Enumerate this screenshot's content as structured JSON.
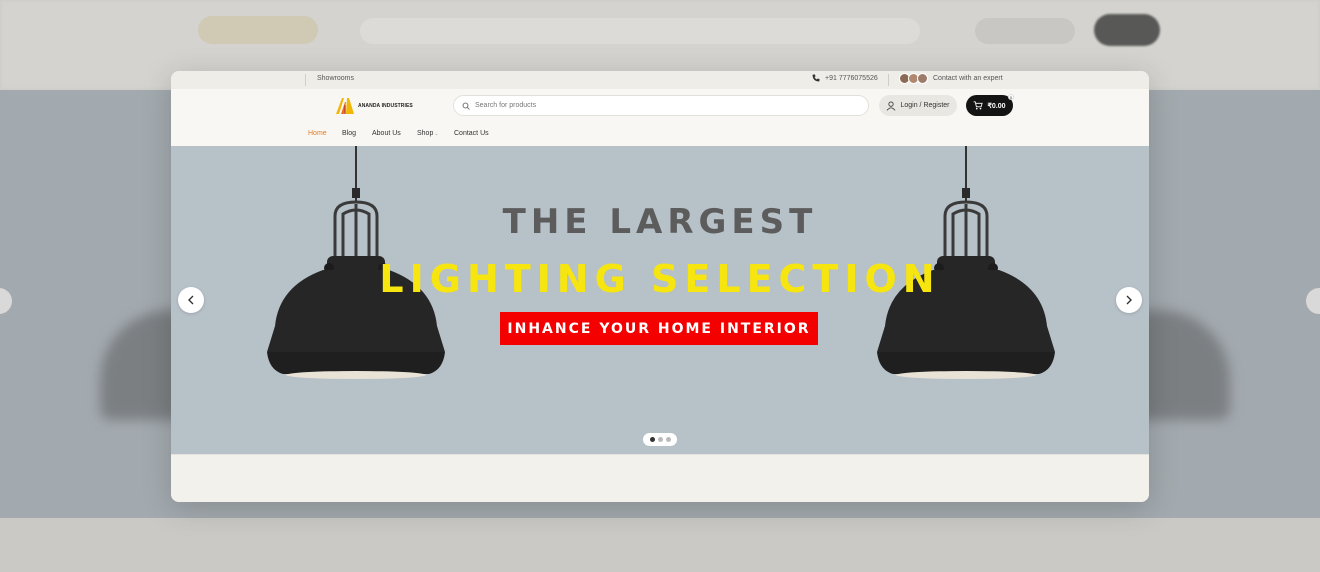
{
  "topbar": {
    "showrooms": "Showrooms",
    "phone": "+91 7776075526",
    "expert": "Contact with an expert"
  },
  "header": {
    "logo_text": "ANANDA INDUSTRIES",
    "search_placeholder": "Search for products",
    "login_label": "Login / Register",
    "cart_total": "₹0.00",
    "cart_count": "0"
  },
  "nav": {
    "items": [
      {
        "label": "Home",
        "active": true
      },
      {
        "label": "Blog"
      },
      {
        "label": "About Us"
      },
      {
        "label": "Shop",
        "has_dropdown": true
      },
      {
        "label": "Contact Us"
      }
    ]
  },
  "hero": {
    "line1": "THE LARGEST",
    "line2": "LIGHTING SELECTION",
    "cta": "INHANCE YOUR HOME INTERIOR",
    "slide_count": 3,
    "active_slide": 1
  },
  "colors": {
    "accent": "#e27d2a",
    "hero_bg": "#b7c1c8",
    "headline_yellow": "#f7e50f",
    "cta_red": "#f50000",
    "cart_bg": "#141414"
  },
  "icons": [
    "phone-icon",
    "search-icon",
    "user-icon",
    "cart-icon",
    "chevron-left-icon",
    "chevron-right-icon"
  ]
}
